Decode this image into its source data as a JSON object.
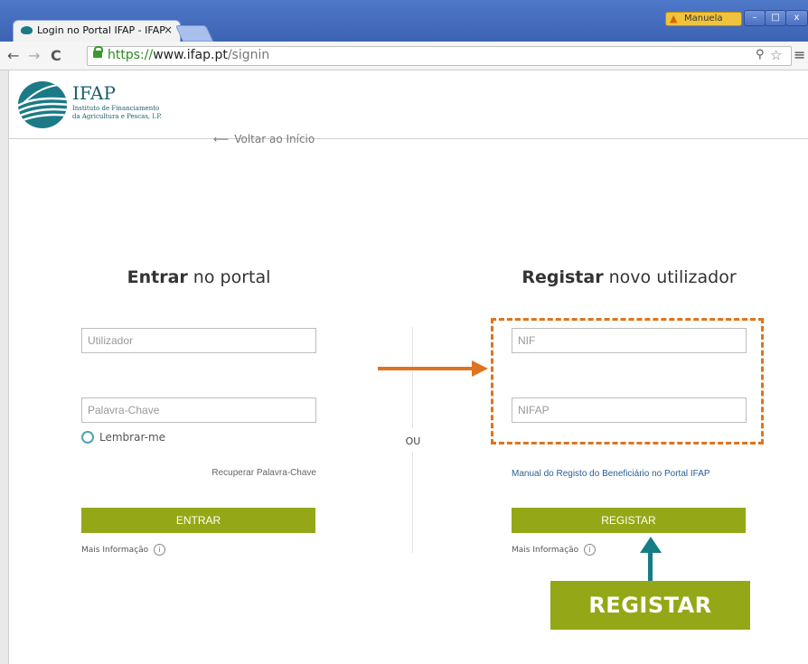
{
  "browser": {
    "tab_title": "Login no Portal IFAP - IFAP",
    "tab_close": "×",
    "user_name": "Manuela",
    "window_buttons": [
      "–",
      "□",
      "x"
    ],
    "url_https": "https://",
    "url_host": "www.ifap.pt",
    "url_path": "/signin",
    "icons": [
      "back-arrow-icon",
      "forward-arrow-icon",
      "reload-icon",
      "lock-icon",
      "zoom-icon",
      "star-icon",
      "menu-icon"
    ]
  },
  "header": {
    "logo_text": "IFAP",
    "logo_subtitle_1": "Instituto de Financiamento",
    "logo_subtitle_2": "da Agricultura e Pescas, I.P.",
    "back_link": "Voltar ao Início"
  },
  "login": {
    "title_bold": "Entrar",
    "title_rest": " no portal",
    "username_placeholder": "Utilizador",
    "password_placeholder": "Palavra-Chave",
    "remember": "Lembrar-me",
    "recover": "Recuperar Palavra-Chave",
    "button": "ENTRAR",
    "more_info": "Mais Informação"
  },
  "separator": "OU",
  "register": {
    "title_bold": "Registar",
    "title_rest": " novo utilizador",
    "nif_placeholder": "NIF",
    "nifap_placeholder": "NIFAP",
    "manual_link": "Manual do Registo do Beneficiário no Portal IFAP",
    "button": "REGISTAR",
    "more_info": "Mais Informação"
  },
  "annotation": {
    "callout": "REGISTAR",
    "arrow_color": "#e0731d",
    "callout_arrow_color": "#157e84"
  },
  "colors": {
    "button": "#94a817",
    "brand": "#1b5f6b"
  }
}
